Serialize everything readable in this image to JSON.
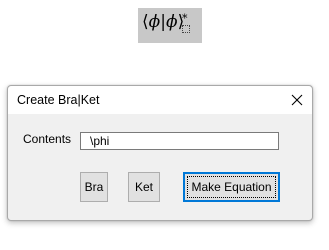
{
  "preview": {
    "bra_open": "⟨",
    "bra_symbol": "ϕ",
    "separator": "|",
    "ket_symbol": "ϕ",
    "ket_close": "⟩",
    "superscript": "*",
    "background_color": "#c8c8c8"
  },
  "dialog": {
    "title": "Create Bra|Ket",
    "close_icon": "close-icon",
    "contents_label": "Contents",
    "contents_value": "\\phi",
    "buttons": {
      "bra": "Bra",
      "ket": "Ket",
      "make_equation": "Make Equation"
    },
    "accent_color": "#0078d7"
  }
}
